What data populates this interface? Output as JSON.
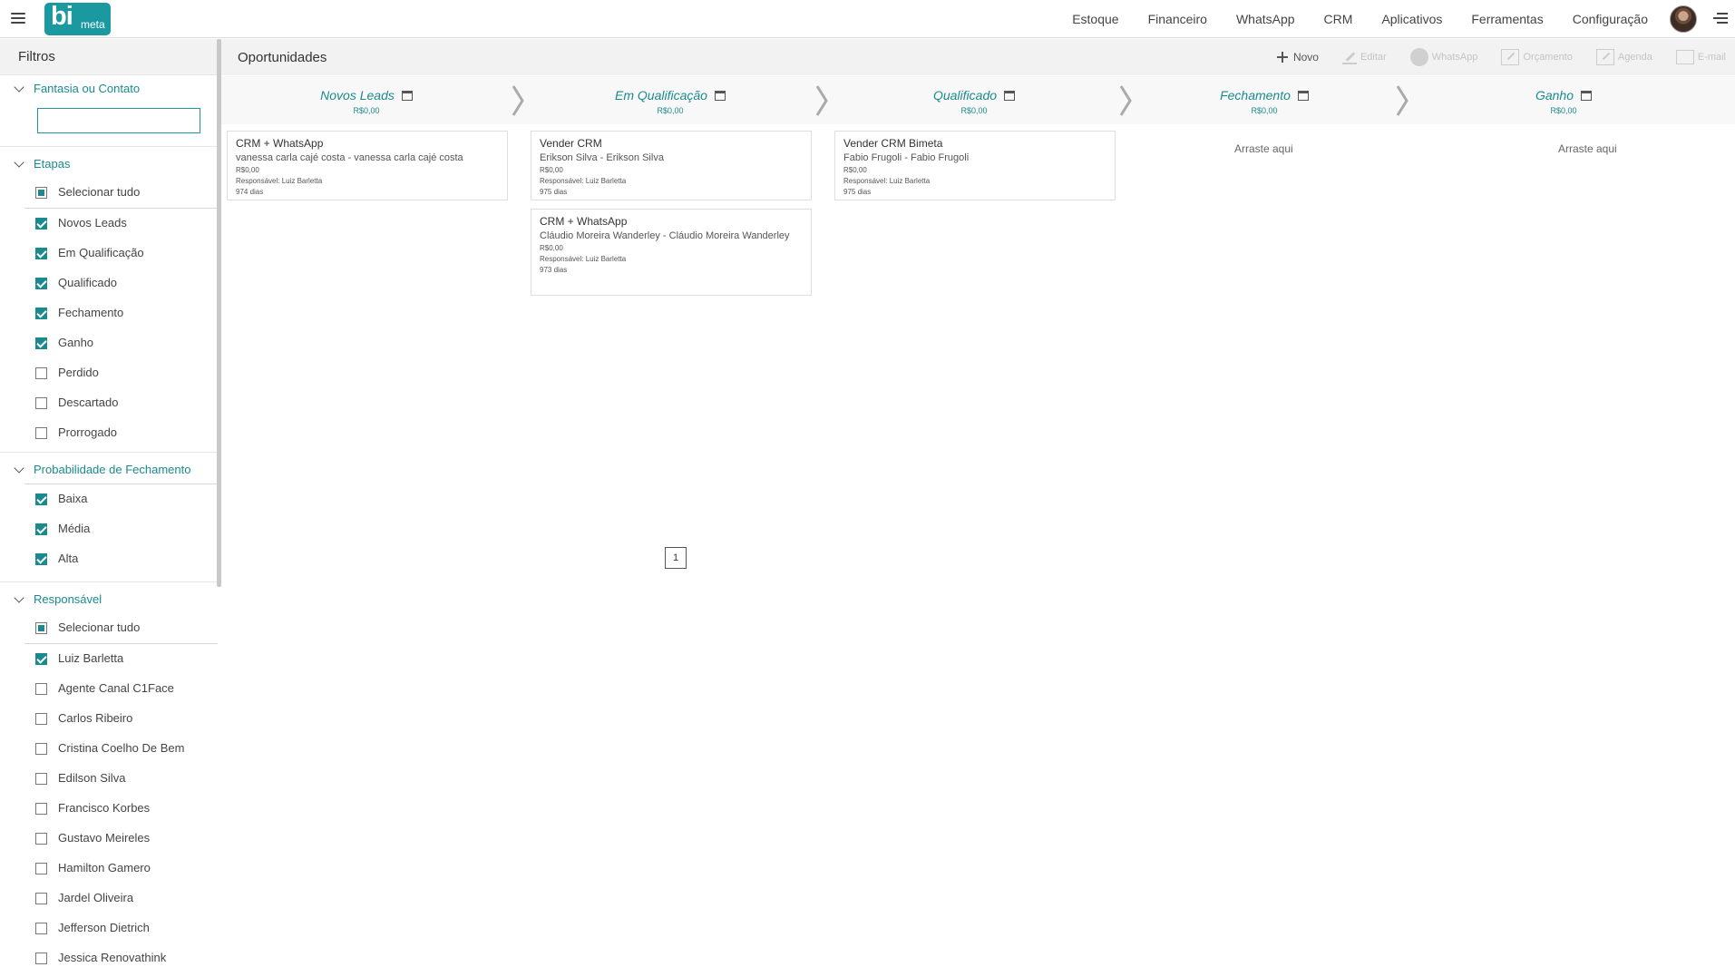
{
  "topbar": {
    "logo_big": "bi",
    "logo_small": "meta",
    "nav": [
      "Estoque",
      "Financeiro",
      "WhatsApp",
      "CRM",
      "Aplicativos",
      "Ferramentas",
      "Configuração"
    ]
  },
  "sidebar": {
    "title": "Filtros",
    "search_section": {
      "title": "Fantasia ou Contato",
      "value": ""
    },
    "etapas": {
      "title": "Etapas",
      "select_all": "Selecionar tudo",
      "items": [
        {
          "label": "Novos Leads",
          "checked": true
        },
        {
          "label": "Em Qualificação",
          "checked": true
        },
        {
          "label": "Qualificado",
          "checked": true
        },
        {
          "label": "Fechamento",
          "checked": true
        },
        {
          "label": "Ganho",
          "checked": true
        },
        {
          "label": "Perdido",
          "checked": false
        },
        {
          "label": "Descartado",
          "checked": false
        },
        {
          "label": "Prorrogado",
          "checked": false
        }
      ]
    },
    "probabilidade": {
      "title": "Probabilidade de Fechamento",
      "items": [
        {
          "label": "Baixa",
          "checked": true
        },
        {
          "label": "Média",
          "checked": true
        },
        {
          "label": "Alta",
          "checked": true
        }
      ]
    },
    "responsavel": {
      "title": "Responsável",
      "select_all": "Selecionar tudo",
      "items": [
        {
          "label": "Luiz Barletta",
          "checked": true
        },
        {
          "label": "Agente Canal C1Face",
          "checked": false
        },
        {
          "label": "Carlos Ribeiro",
          "checked": false
        },
        {
          "label": "Cristina Coelho De Bem",
          "checked": false
        },
        {
          "label": "Edilson Silva",
          "checked": false
        },
        {
          "label": "Francisco Korbes",
          "checked": false
        },
        {
          "label": "Gustavo Meireles",
          "checked": false
        },
        {
          "label": "Hamilton Gamero",
          "checked": false
        },
        {
          "label": "Jardel Oliveira",
          "checked": false
        },
        {
          "label": "Jefferson Dietrich",
          "checked": false
        },
        {
          "label": "Jessica Renovathink",
          "checked": false
        }
      ]
    }
  },
  "main": {
    "title": "Oportunidades",
    "toolbar": {
      "novo": "Novo",
      "editar": "Editar",
      "whatsapp": "WhatsApp",
      "orcamento": "Orçamento",
      "agenda": "Agenda",
      "email": "E-mail"
    },
    "stages": [
      {
        "name": "Novos Leads",
        "total": "R$0,00"
      },
      {
        "name": "Em Qualificação",
        "total": "R$0,00"
      },
      {
        "name": "Qualificado",
        "total": "R$0,00"
      },
      {
        "name": "Fechamento",
        "total": "R$0,00"
      },
      {
        "name": "Ganho",
        "total": "R$0,00"
      }
    ],
    "cards": [
      {
        "title": "CRM + WhatsApp",
        "contact": "vanessa carla cajé costa - vanessa carla cajé costa",
        "value": "R$0,00",
        "responsavel": "Responsável: Luiz Barletta",
        "dias": "974 dias"
      },
      {
        "title": "Vender CRM",
        "contact": "Erikson Silva - Erikson Silva",
        "value": "R$0,00",
        "responsavel": "Responsável: Luiz Barletta",
        "dias": "975 dias"
      },
      {
        "title": "CRM + WhatsApp",
        "contact": "Cláudio Moreira Wanderley - Cláudio Moreira Wanderley",
        "value": "R$0,00",
        "responsavel": "Responsável: Luiz Barletta",
        "dias": "973 dias"
      },
      {
        "title": "Vender CRM Bimeta",
        "contact": "Fabio Frugoli - Fabio Frugoli",
        "value": "R$0,00",
        "responsavel": "Responsável: Luiz Barletta",
        "dias": "975 dias"
      }
    ],
    "drop_hint": "Arraste aqui",
    "page": "1"
  },
  "colors": {
    "accent": "#1a8a8e",
    "logo_bg": "#1a9aa0",
    "header_bg": "#f2f2f2"
  }
}
